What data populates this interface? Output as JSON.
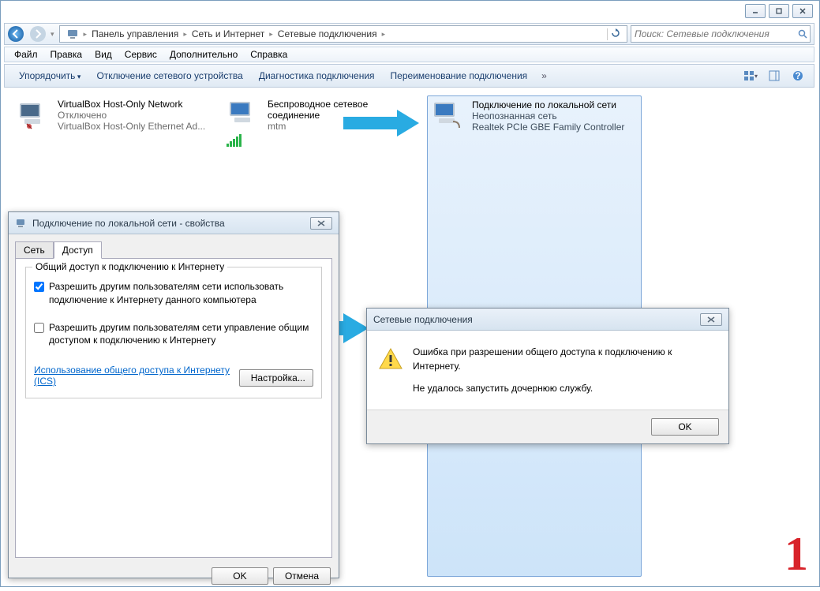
{
  "titlebar": {},
  "nav": {
    "crumbs": [
      "Панель управления",
      "Сеть и Интернет",
      "Сетевые подключения"
    ]
  },
  "search": {
    "placeholder": "Поиск: Сетевые подключения"
  },
  "menu": {
    "items": [
      "Файл",
      "Правка",
      "Вид",
      "Сервис",
      "Дополнительно",
      "Справка"
    ]
  },
  "toolbar": {
    "buttons": [
      "Упорядочить",
      "Отключение сетевого устройства",
      "Диагностика подключения",
      "Переименование подключения"
    ]
  },
  "connections": [
    {
      "name": "VirtualBox Host-Only Network",
      "status": "Отключено",
      "device": "VirtualBox Host-Only Ethernet Ad..."
    },
    {
      "name": "Беспроводное сетевое соединение",
      "status": "",
      "device": "mtm"
    },
    {
      "name": "Подключение по локальной сети",
      "status": "Неопознанная сеть",
      "device": "Realtek PCIe GBE Family Controller"
    }
  ],
  "props": {
    "title": "Подключение по локальной сети - свойства",
    "tabs": {
      "network": "Сеть",
      "access": "Доступ"
    },
    "group_title": "Общий доступ к подключению к Интернету",
    "chk1": "Разрешить другим пользователям сети использовать подключение к Интернету данного компьютера",
    "chk2": "Разрешить другим пользователям сети управление общим доступом к подключению к Интернету",
    "link": "Использование общего доступа к Интернету (ICS)",
    "settings_btn": "Настройка...",
    "ok": "OK",
    "cancel": "Отмена"
  },
  "err": {
    "title": "Сетевые подключения",
    "line1": "Ошибка при разрешении общего доступа к подключению к Интернету.",
    "line2": "Не удалось запустить дочернюю службу.",
    "ok": "OK"
  },
  "marker": "1"
}
